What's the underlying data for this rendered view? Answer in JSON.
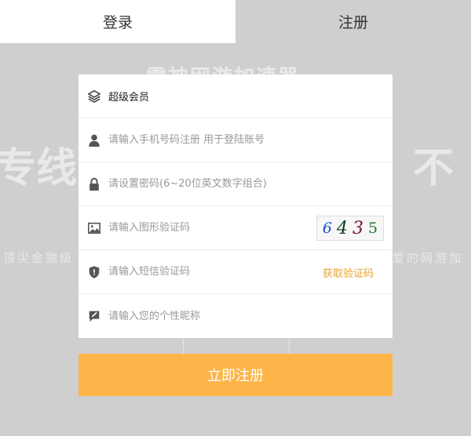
{
  "tabs": [
    {
      "label": "登录",
      "active": true
    },
    {
      "label": "注册",
      "active": false
    }
  ],
  "background": {
    "heading": "雷神网游加速器",
    "big_left": "专线",
    "big_right": "不",
    "line_left": "顶尖金融级",
    "line_right": "爱的网游加"
  },
  "form": {
    "title": "超级会员",
    "phone_placeholder": "请输入手机号码注册 用于登陆账号",
    "password_placeholder": "请设置密码(6~20位英文数字组合)",
    "image_code_placeholder": "请输入图形验证码",
    "captcha": {
      "chars": [
        "6",
        "4",
        "3",
        "5"
      ],
      "colors": [
        "#1a4fd8",
        "#103818",
        "#7a1040",
        "#1a7a2a"
      ]
    },
    "sms_code_placeholder": "请输入短信验证码",
    "get_code_label": "获取验证码",
    "nickname_placeholder": "请输入您的个性昵称"
  },
  "submit_label": "立即注册",
  "colors": {
    "accent": "#fdb549",
    "link": "#e8a32b",
    "background": "#cfcfcf"
  },
  "icons": [
    "layers-icon",
    "user-icon",
    "lock-icon",
    "image-icon",
    "shield-icon",
    "edit-icon"
  ]
}
